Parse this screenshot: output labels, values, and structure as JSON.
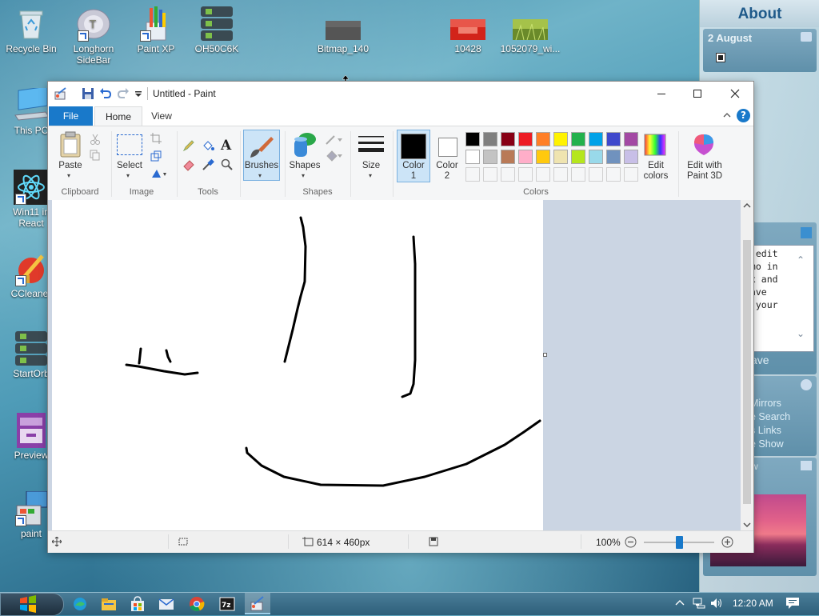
{
  "desktop": {
    "icons": [
      {
        "label": "Recycle Bin"
      },
      {
        "label": "Longhorn SideBar"
      },
      {
        "label": "Paint XP"
      },
      {
        "label": "OH50C6K"
      },
      {
        "label": "Bitmap_140"
      },
      {
        "label": "10428"
      },
      {
        "label": "1052079_wi..."
      },
      {
        "label": "This PC"
      },
      {
        "label": "Win11 in React"
      },
      {
        "label": "CCleaner"
      },
      {
        "label": "StartOrb"
      },
      {
        "label": "Preview"
      },
      {
        "label": "paint"
      }
    ]
  },
  "sidebar": {
    "title": "About",
    "date": "2 August",
    "memo_text": "n edit\nemo in\nox and\nSave\ne your",
    "save_label": "ave",
    "links": [
      "Mirrors",
      "e Search",
      "s Links",
      "e Show"
    ],
    "partial_label": "w"
  },
  "window": {
    "title": "Untitled - Paint",
    "tabs": {
      "file": "File",
      "home": "Home",
      "view": "View"
    },
    "ribbon": {
      "clipboard": {
        "paste": "Paste",
        "group": "Clipboard"
      },
      "image": {
        "select": "Select",
        "group": "Image"
      },
      "tools": {
        "group": "Tools"
      },
      "brushes": {
        "label": "Brushes"
      },
      "shapes": {
        "label": "Shapes",
        "group": "Shapes"
      },
      "size": {
        "label": "Size"
      },
      "color1": {
        "label": "Color 1"
      },
      "color2": {
        "label": "Color 2"
      },
      "edit_colors": "Edit colors",
      "paint3d": "Edit with Paint 3D",
      "colors_group": "Colors"
    },
    "palette": {
      "row1": [
        "#000000",
        "#7f7f7f",
        "#880015",
        "#ed1c24",
        "#ff7f27",
        "#fff200",
        "#22b14c",
        "#00a2e8",
        "#3f48cc",
        "#a349a4"
      ],
      "row2": [
        "#ffffff",
        "#c3c3c3",
        "#b97a57",
        "#ffaec9",
        "#ffc90e",
        "#efe4b0",
        "#b5e61d",
        "#99d9ea",
        "#7092be",
        "#c8bfe7"
      ],
      "row3": [
        "#f5f6f7",
        "#f5f6f7",
        "#f5f6f7",
        "#f5f6f7",
        "#f5f6f7",
        "#f5f6f7",
        "#f5f6f7",
        "#f5f6f7",
        "#f5f6f7",
        "#f5f6f7"
      ]
    },
    "color1_value": "#000000",
    "color2_value": "#ffffff",
    "status": {
      "dimensions": "614 × 460px",
      "zoom": "100%",
      "zoom_level_fraction": 0.5
    }
  },
  "taskbar": {
    "time": "12:20 AM"
  },
  "colors": {
    "accent": "#1979ca"
  }
}
